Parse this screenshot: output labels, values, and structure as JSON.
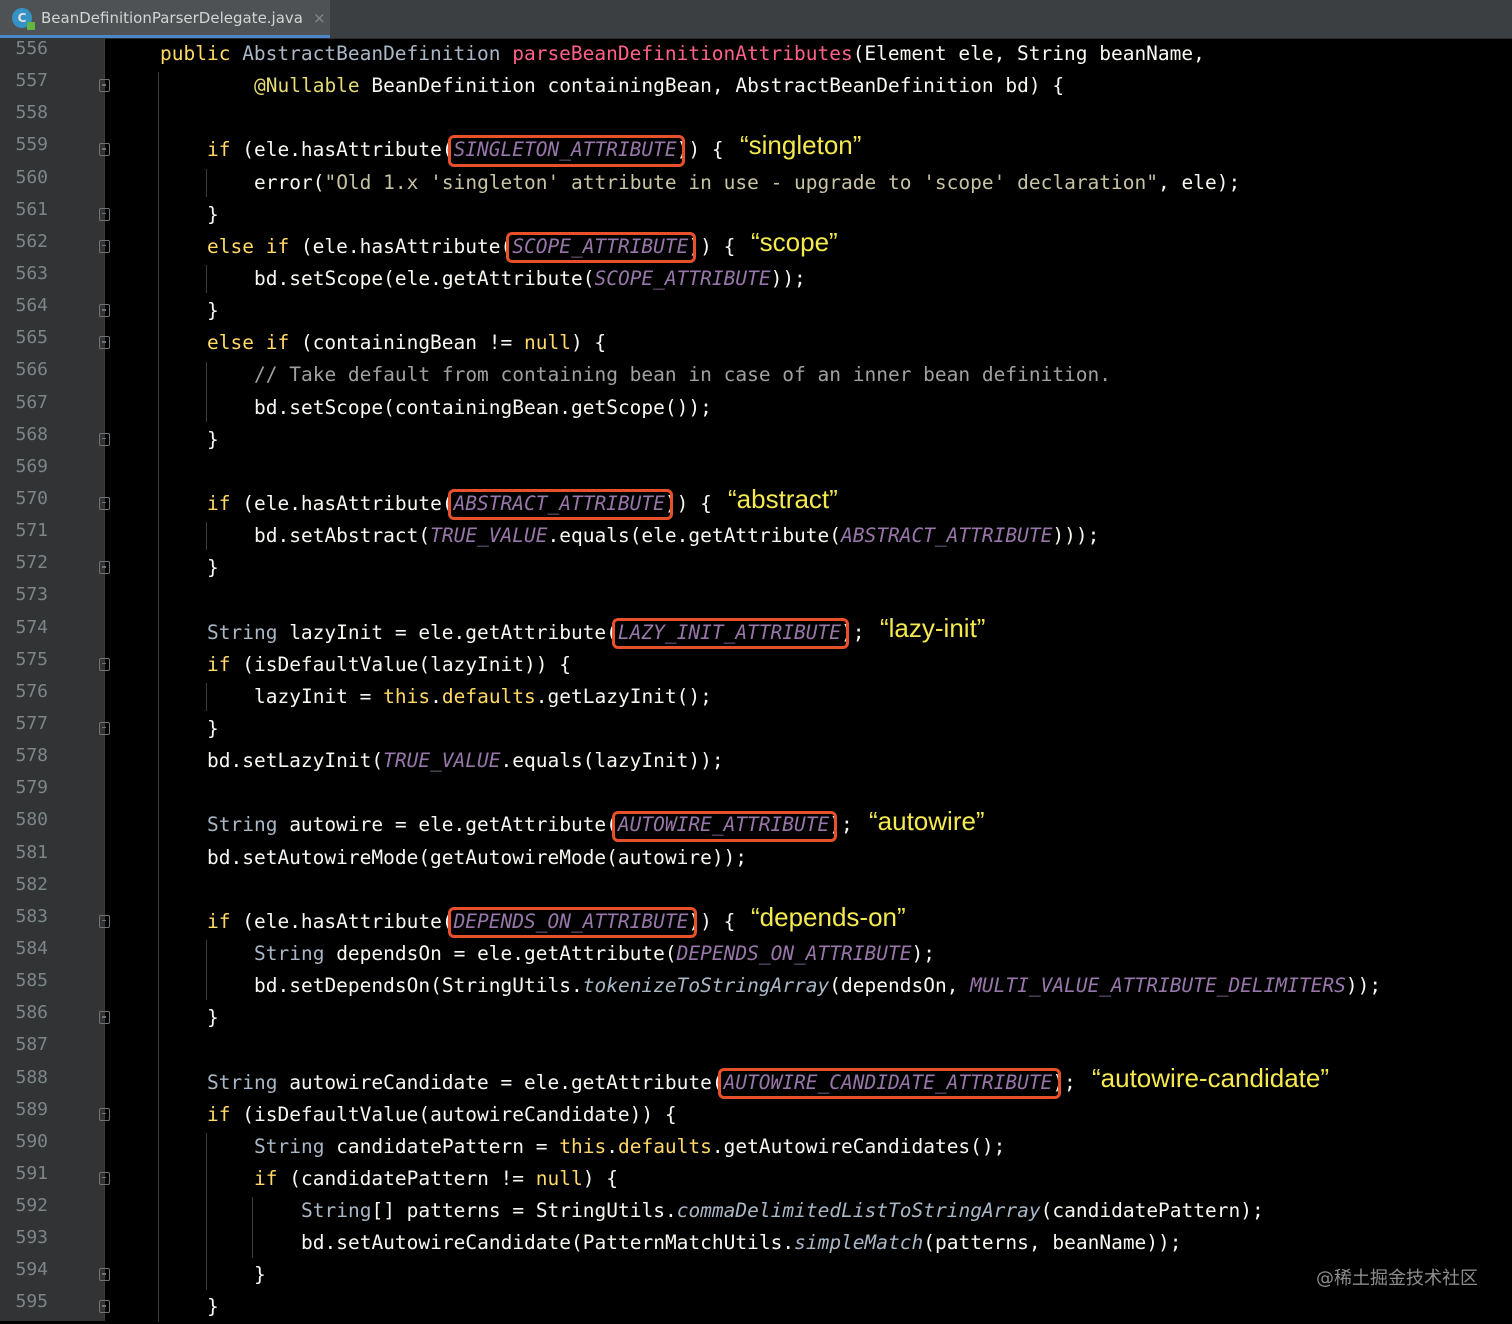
{
  "editor": {
    "tab": {
      "icon": "java-class-icon",
      "title": "BeanDefinitionParserDelegate.java",
      "close": "×"
    },
    "watermark": "@稀土掘金技术社区"
  },
  "lines": [
    {
      "n": "556",
      "fold": false,
      "indent": 1,
      "t": [
        [
          "kw-y",
          "public "
        ],
        [
          "ty",
          "AbstractBeanDefinition "
        ],
        [
          "fn",
          "parseBeanDefinitionAttributes"
        ],
        [
          "white",
          "(Element ele, String beanName,"
        ]
      ]
    },
    {
      "n": "557",
      "fold": true,
      "indent": 3,
      "t": [
        [
          "ann",
          "@Nullable "
        ],
        [
          "white",
          "BeanDefinition containingBean, AbstractBeanDefinition bd) {"
        ]
      ]
    },
    {
      "n": "558",
      "fold": false,
      "indent": 0,
      "t": []
    },
    {
      "n": "559",
      "fold": true,
      "indent": 2,
      "t": [
        [
          "kw-y",
          "if "
        ],
        [
          "white",
          "(ele.hasAttribute("
        ],
        [
          "const",
          "SINGLETON_ATTRIBUTE"
        ],
        [
          "white",
          ")) {"
        ]
      ]
    },
    {
      "n": "560",
      "fold": false,
      "indent": 3,
      "t": [
        [
          "white",
          "error("
        ],
        [
          "str",
          "\"Old 1.x 'singleton' attribute in use - upgrade to 'scope' declaration\""
        ],
        [
          "white",
          ", ele);"
        ]
      ]
    },
    {
      "n": "561",
      "fold": true,
      "indent": 2,
      "t": [
        [
          "white",
          "}"
        ]
      ]
    },
    {
      "n": "562",
      "fold": true,
      "indent": 2,
      "t": [
        [
          "kw-y",
          "else if "
        ],
        [
          "white",
          "(ele.hasAttribute("
        ],
        [
          "const",
          "SCOPE_ATTRIBUTE"
        ],
        [
          "white",
          ")) {"
        ]
      ]
    },
    {
      "n": "563",
      "fold": false,
      "indent": 3,
      "t": [
        [
          "white",
          "bd.setScope(ele.getAttribute("
        ],
        [
          "const",
          "SCOPE_ATTRIBUTE"
        ],
        [
          "white",
          "));"
        ]
      ]
    },
    {
      "n": "564",
      "fold": true,
      "indent": 2,
      "t": [
        [
          "white",
          "}"
        ]
      ]
    },
    {
      "n": "565",
      "fold": true,
      "indent": 2,
      "t": [
        [
          "kw-y",
          "else if "
        ],
        [
          "white",
          "(containingBean != "
        ],
        [
          "kw-y",
          "null"
        ],
        [
          "white",
          ") {"
        ]
      ]
    },
    {
      "n": "566",
      "fold": false,
      "indent": 3,
      "t": [
        [
          "cmt",
          "// Take default from containing bean in case of an inner bean definition."
        ]
      ]
    },
    {
      "n": "567",
      "fold": false,
      "indent": 3,
      "t": [
        [
          "white",
          "bd.setScope(containingBean.getScope());"
        ]
      ]
    },
    {
      "n": "568",
      "fold": true,
      "indent": 2,
      "t": [
        [
          "white",
          "}"
        ]
      ]
    },
    {
      "n": "569",
      "fold": false,
      "indent": 0,
      "t": []
    },
    {
      "n": "570",
      "fold": true,
      "indent": 2,
      "t": [
        [
          "kw-y",
          "if "
        ],
        [
          "white",
          "(ele.hasAttribute("
        ],
        [
          "const",
          "ABSTRACT_ATTRIBUTE"
        ],
        [
          "white",
          ")) {"
        ]
      ]
    },
    {
      "n": "571",
      "fold": false,
      "indent": 3,
      "t": [
        [
          "white",
          "bd.setAbstract("
        ],
        [
          "const",
          "TRUE_VALUE"
        ],
        [
          "white",
          ".equals(ele.getAttribute("
        ],
        [
          "const",
          "ABSTRACT_ATTRIBUTE"
        ],
        [
          "white",
          ")));"
        ]
      ]
    },
    {
      "n": "572",
      "fold": true,
      "indent": 2,
      "t": [
        [
          "white",
          "}"
        ]
      ]
    },
    {
      "n": "573",
      "fold": false,
      "indent": 0,
      "t": []
    },
    {
      "n": "574",
      "fold": false,
      "indent": 2,
      "t": [
        [
          "ty",
          "String "
        ],
        [
          "white",
          "lazyInit = ele.getAttribute("
        ],
        [
          "const",
          "LAZY_INIT_ATTRIBUTE"
        ],
        [
          "white",
          ");"
        ]
      ]
    },
    {
      "n": "575",
      "fold": true,
      "indent": 2,
      "t": [
        [
          "kw-y",
          "if "
        ],
        [
          "white",
          "(isDefaultValue(lazyInit)) {"
        ]
      ]
    },
    {
      "n": "576",
      "fold": false,
      "indent": 3,
      "t": [
        [
          "white",
          "lazyInit = "
        ],
        [
          "kw-y",
          "this"
        ],
        [
          "white",
          "."
        ],
        [
          "field",
          "defaults"
        ],
        [
          "white",
          ".getLazyInit();"
        ]
      ]
    },
    {
      "n": "577",
      "fold": true,
      "indent": 2,
      "t": [
        [
          "white",
          "}"
        ]
      ]
    },
    {
      "n": "578",
      "fold": false,
      "indent": 2,
      "t": [
        [
          "white",
          "bd.setLazyInit("
        ],
        [
          "const",
          "TRUE_VALUE"
        ],
        [
          "white",
          ".equals(lazyInit));"
        ]
      ]
    },
    {
      "n": "579",
      "fold": false,
      "indent": 0,
      "t": []
    },
    {
      "n": "580",
      "fold": false,
      "indent": 2,
      "t": [
        [
          "ty",
          "String "
        ],
        [
          "white",
          "autowire = ele.getAttribute("
        ],
        [
          "const",
          "AUTOWIRE_ATTRIBUTE"
        ],
        [
          "white",
          ");"
        ]
      ]
    },
    {
      "n": "581",
      "fold": false,
      "indent": 2,
      "t": [
        [
          "white",
          "bd.setAutowireMode(getAutowireMode(autowire));"
        ]
      ]
    },
    {
      "n": "582",
      "fold": false,
      "indent": 0,
      "t": []
    },
    {
      "n": "583",
      "fold": true,
      "indent": 2,
      "t": [
        [
          "kw-y",
          "if "
        ],
        [
          "white",
          "(ele.hasAttribute("
        ],
        [
          "const",
          "DEPENDS_ON_ATTRIBUTE"
        ],
        [
          "white",
          ")) {"
        ]
      ]
    },
    {
      "n": "584",
      "fold": false,
      "indent": 3,
      "t": [
        [
          "ty",
          "String "
        ],
        [
          "white",
          "dependsOn = ele.getAttribute("
        ],
        [
          "const",
          "DEPENDS_ON_ATTRIBUTE"
        ],
        [
          "white",
          ");"
        ]
      ]
    },
    {
      "n": "585",
      "fold": false,
      "indent": 3,
      "t": [
        [
          "white",
          "bd.setDependsOn(StringUtils."
        ],
        [
          "italic-m",
          "tokenizeToStringArray"
        ],
        [
          "white",
          "(dependsOn, "
        ],
        [
          "const",
          "MULTI_VALUE_ATTRIBUTE_DELIMITERS"
        ],
        [
          "white",
          "));"
        ]
      ]
    },
    {
      "n": "586",
      "fold": true,
      "indent": 2,
      "t": [
        [
          "white",
          "}"
        ]
      ]
    },
    {
      "n": "587",
      "fold": false,
      "indent": 0,
      "t": []
    },
    {
      "n": "588",
      "fold": false,
      "indent": 2,
      "t": [
        [
          "ty",
          "String "
        ],
        [
          "white",
          "autowireCandidate = ele.getAttribute("
        ],
        [
          "const",
          "AUTOWIRE_CANDIDATE_ATTRIBUTE"
        ],
        [
          "white",
          ");"
        ]
      ]
    },
    {
      "n": "589",
      "fold": true,
      "indent": 2,
      "t": [
        [
          "kw-y",
          "if "
        ],
        [
          "white",
          "(isDefaultValue(autowireCandidate)) {"
        ]
      ]
    },
    {
      "n": "590",
      "fold": false,
      "indent": 3,
      "t": [
        [
          "ty",
          "String "
        ],
        [
          "white",
          "candidatePattern = "
        ],
        [
          "kw-y",
          "this"
        ],
        [
          "white",
          "."
        ],
        [
          "field",
          "defaults"
        ],
        [
          "white",
          ".getAutowireCandidates();"
        ]
      ]
    },
    {
      "n": "591",
      "fold": true,
      "indent": 3,
      "t": [
        [
          "kw-y",
          "if "
        ],
        [
          "white",
          "(candidatePattern != "
        ],
        [
          "kw-y",
          "null"
        ],
        [
          "white",
          ") {"
        ]
      ]
    },
    {
      "n": "592",
      "fold": false,
      "indent": 4,
      "t": [
        [
          "ty",
          "String"
        ],
        [
          "white",
          "[] patterns = StringUtils."
        ],
        [
          "italic-m",
          "commaDelimitedListToStringArray"
        ],
        [
          "white",
          "(candidatePattern);"
        ]
      ]
    },
    {
      "n": "593",
      "fold": false,
      "indent": 4,
      "t": [
        [
          "white",
          "bd.setAutowireCandidate(PatternMatchUtils."
        ],
        [
          "italic-m",
          "simpleMatch"
        ],
        [
          "white",
          "(patterns, beanName));"
        ]
      ]
    },
    {
      "n": "594",
      "fold": true,
      "indent": 3,
      "t": [
        [
          "white",
          "}"
        ]
      ]
    },
    {
      "n": "595",
      "fold": true,
      "indent": 2,
      "t": [
        [
          "white",
          "}"
        ]
      ]
    }
  ],
  "annotations": [
    {
      "line": 3,
      "text": "“singleton”"
    },
    {
      "line": 6,
      "text": "“scope”"
    },
    {
      "line": 14,
      "text": "“abstract”"
    },
    {
      "line": 18,
      "text": "“lazy-init”"
    },
    {
      "line": 24,
      "text": "“autowire”"
    },
    {
      "line": 27,
      "text": "“depends-on”"
    },
    {
      "line": 32,
      "text": "“autowire-candidate”"
    }
  ],
  "colors": {
    "background": "#000000",
    "gutter": "#313335",
    "highlight_box": "#e8502a",
    "annotation_text": "#f4e94e"
  }
}
